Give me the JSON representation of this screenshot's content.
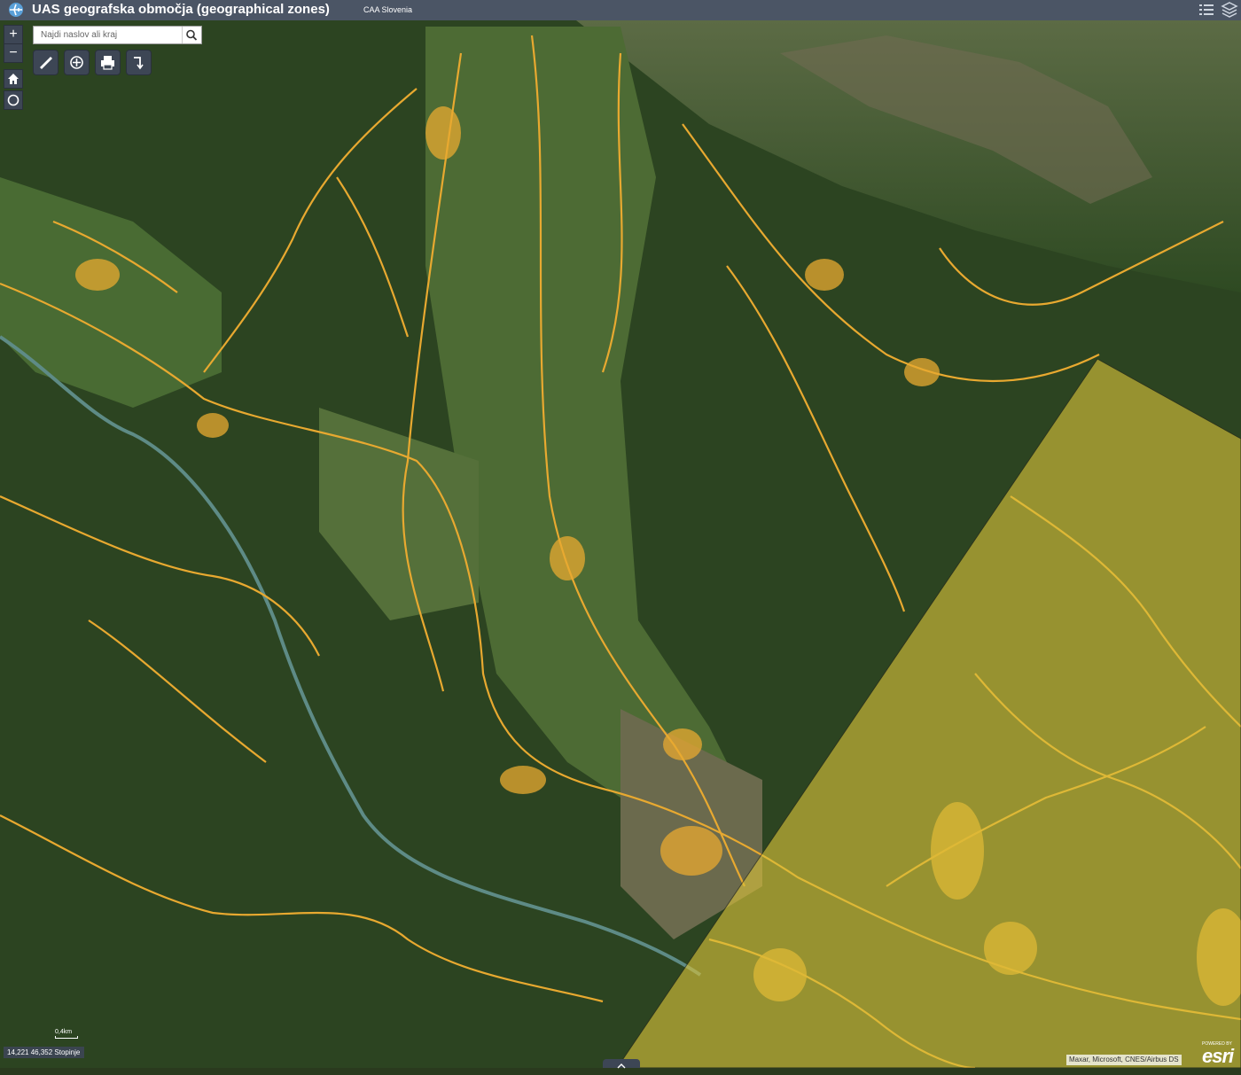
{
  "header": {
    "title": "UAS geografska območja (geographical zones)",
    "subtitle": "CAA Slovenia",
    "logo_icon": "airplane-icon",
    "right_buttons": [
      "layer-list-icon",
      "layers-icon"
    ]
  },
  "map_controls": {
    "zoom_in_label": "+",
    "zoom_out_label": "−",
    "home_icon": "home-icon",
    "locate_icon": "locate-icon"
  },
  "search": {
    "placeholder": "Najdi naslov ali kraj",
    "value": ""
  },
  "toolbar": [
    "measure-icon",
    "directions-icon",
    "print-icon",
    "draw-icon"
  ],
  "coordinates": "14,221 46,352 Stopinje",
  "scalebar": {
    "label": "0,4km"
  },
  "attribution": "Maxar, Microsoft, CNES/Airbus DS",
  "esri": {
    "powered_by": "POWERED BY",
    "brand": "esri"
  },
  "colors": {
    "header_bg": "#4b5565",
    "road_network": "#e8a930",
    "restricted_zone_fill": "#d9c23a"
  }
}
